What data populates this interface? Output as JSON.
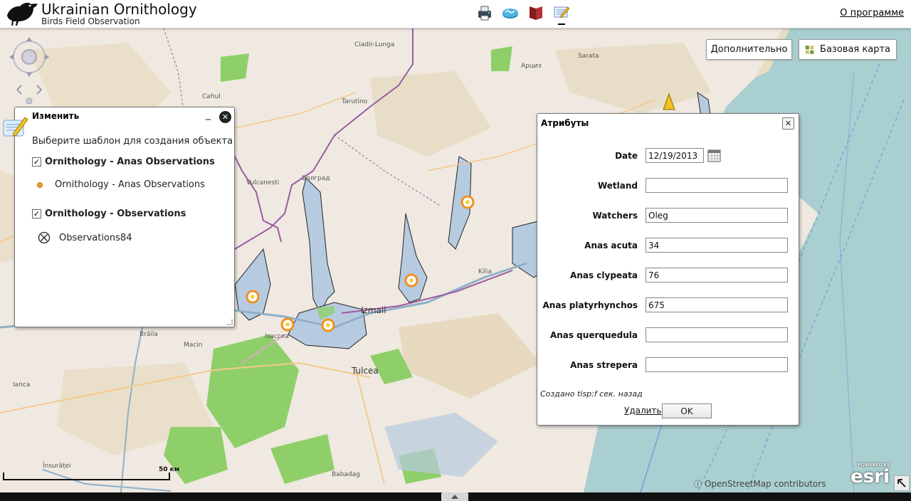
{
  "header": {
    "title": "Ukrainian Ornithology",
    "subtitle": "Birds Field Observation",
    "about_link": "О программе",
    "tools": [
      "print-icon",
      "measure-icon",
      "book-icon",
      "edit-icon"
    ]
  },
  "map": {
    "more_button": "Дополнительно",
    "basemap_button": "Базовая карта",
    "scale_label": "50 км",
    "attribution": "OpenStreetMap contributors",
    "esri_powered": "POWERED BY",
    "esri_name": "esri",
    "labels": {
      "braila": "Brăila",
      "tulcea": "Tulcea",
      "izmail": "Izmail",
      "kilia": "Kilia",
      "vulcanesti": "Vulcanesti",
      "cahul": "Cahul",
      "isaccea": "Isaccea",
      "macin": "Macin",
      "ianca": "Ianca",
      "bolgrad": "Болград",
      "tarutino": "Tarutino",
      "arciz": "Арциз",
      "sarata": "Sarata",
      "ciadir": "Ciadir-Lunga",
      "babadag": "Babadag",
      "insuratei": "Însurăței"
    }
  },
  "edit_panel": {
    "title": "Изменить",
    "minimize": "_",
    "hint": "Выберите шаблон для создания объекта",
    "layers": [
      {
        "name": "Ornithology - Anas Observations",
        "checked": true,
        "template": "Ornithology - Anas Observations"
      },
      {
        "name": "Ornithology - Observations",
        "checked": true,
        "template": "Observations84"
      }
    ]
  },
  "attributes": {
    "title": "Атрибуты",
    "fields": {
      "date": {
        "label": "Date",
        "value": "12/19/2013"
      },
      "wetland": {
        "label": "Wetland",
        "value": ""
      },
      "watchers": {
        "label": "Watchers",
        "value": "Oleg"
      },
      "anas_acuta": {
        "label": "Anas acuta",
        "value": "34"
      },
      "anas_clypeata": {
        "label": "Anas clypeata",
        "value": "76"
      },
      "anas_platyrhynchos": {
        "label": "Anas platyrhynchos",
        "value": "675"
      },
      "anas_querquedula": {
        "label": "Anas querquedula",
        "value": ""
      },
      "anas_strepera": {
        "label": "Anas strepera",
        "value": ""
      }
    },
    "created_text": "Создано tisp:f сек. назад",
    "delete_label": "Удалить",
    "ok_label": "OK"
  },
  "colors": {
    "water": "#aacfd0",
    "lake": "#b7cbe0",
    "forest": "#8fcf6a",
    "border": "#9a5ba3",
    "sea_line": "#6f8fdc"
  }
}
